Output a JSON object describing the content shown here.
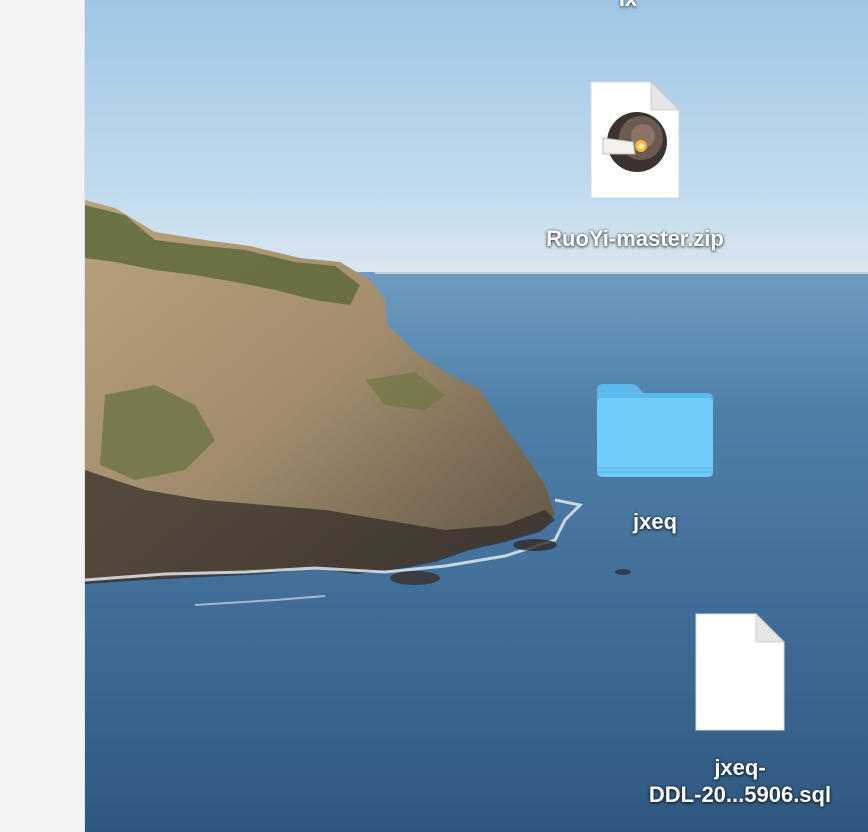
{
  "desktop": {
    "top_partial_label": "Ix",
    "items": [
      {
        "label": "RuoYi-master.zip",
        "kind": "archive",
        "icon": "archive-utility-icon"
      },
      {
        "label": "jxeq",
        "kind": "folder",
        "icon": "folder-icon"
      },
      {
        "label_line1": "jxeq-",
        "label_line2": "DDL-20...5906.sql",
        "kind": "document",
        "icon": "blank-document-icon"
      }
    ]
  },
  "colors": {
    "sidebar": "#f3f3f3",
    "sky": "#a9cde6",
    "sea": "#3d6c97",
    "folder": "#64c4f5"
  }
}
